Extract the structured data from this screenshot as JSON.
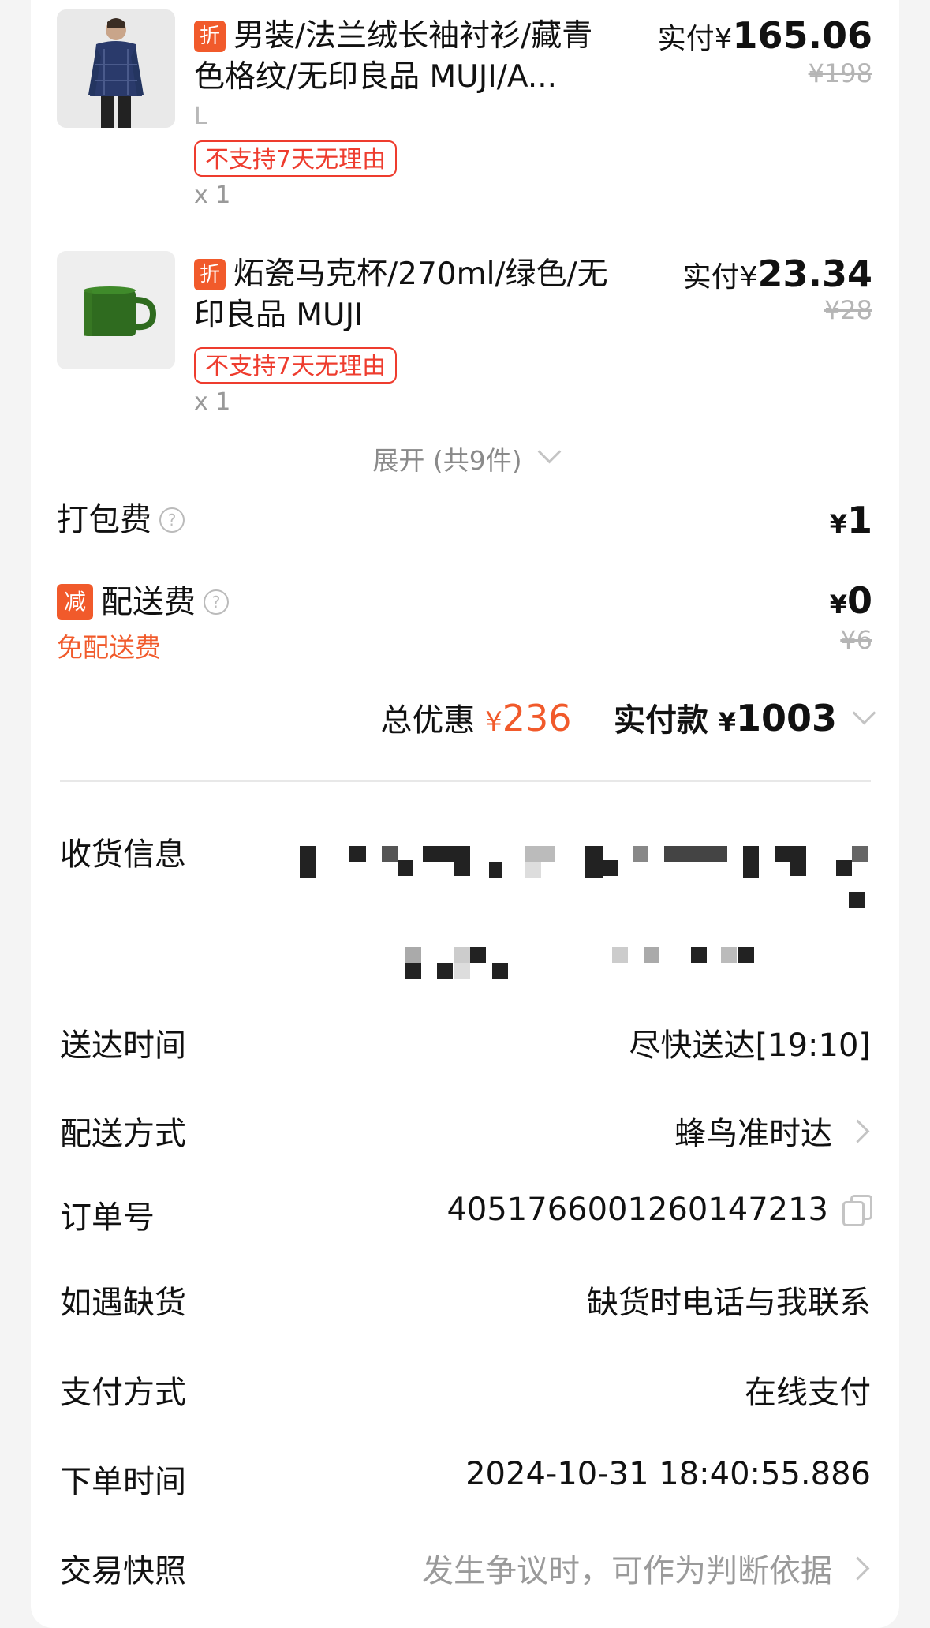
{
  "products": [
    {
      "title": "男装/法兰绒长袖衬衫/藏青色格纹/无印良品 MUJI/A...",
      "discount_tag": "折",
      "spec": "L",
      "badge": "不支持7天无理由",
      "qty": "x 1",
      "paid_label": "实付¥",
      "paid_amount": "165.06",
      "original_price": "¥198"
    },
    {
      "title": "炻瓷马克杯/270ml/绿色/无印良品 MUJI",
      "discount_tag": "折",
      "badge": "不支持7天无理由",
      "qty": "x 1",
      "paid_label": "实付¥",
      "paid_amount": "23.34",
      "original_price": "¥28"
    }
  ],
  "expand_label": "展开 (共9件)",
  "fees": {
    "packing": {
      "label": "打包费",
      "currency": "¥",
      "amount": "1"
    },
    "delivery": {
      "tag": "减",
      "label": "配送费",
      "currency": "¥",
      "amount": "0",
      "original": "¥6",
      "note": "免配送费"
    }
  },
  "totals": {
    "discount_label": "总优惠",
    "discount_currency": "¥",
    "discount_amount": "236",
    "paid_label": "实付款",
    "paid_currency": "¥",
    "paid_amount": "1003"
  },
  "info": {
    "address_label": "收货信息",
    "delivery_time_label": "送达时间",
    "delivery_time_value": "尽快送达[19:10]",
    "delivery_method_label": "配送方式",
    "delivery_method_value": "蜂鸟准时达",
    "order_no_label": "订单号",
    "order_no_value": "4051766001260147213",
    "out_of_stock_label": "如遇缺货",
    "out_of_stock_value": "缺货时电话与我联系",
    "payment_label": "支付方式",
    "payment_value": "在线支付",
    "order_time_label": "下单时间",
    "order_time_value": "2024-10-31 18:40:55.886",
    "snapshot_label": "交易快照",
    "snapshot_value": "发生争议时，可作为判断依据"
  },
  "colors": {
    "accent": "#f15a2b",
    "badge_red": "#ee3c2e",
    "muted": "#9a9a9a"
  },
  "icons": [
    "discount-tag-icon",
    "help-icon",
    "chevron-down-icon",
    "chevron-right-icon",
    "copy-icon"
  ]
}
